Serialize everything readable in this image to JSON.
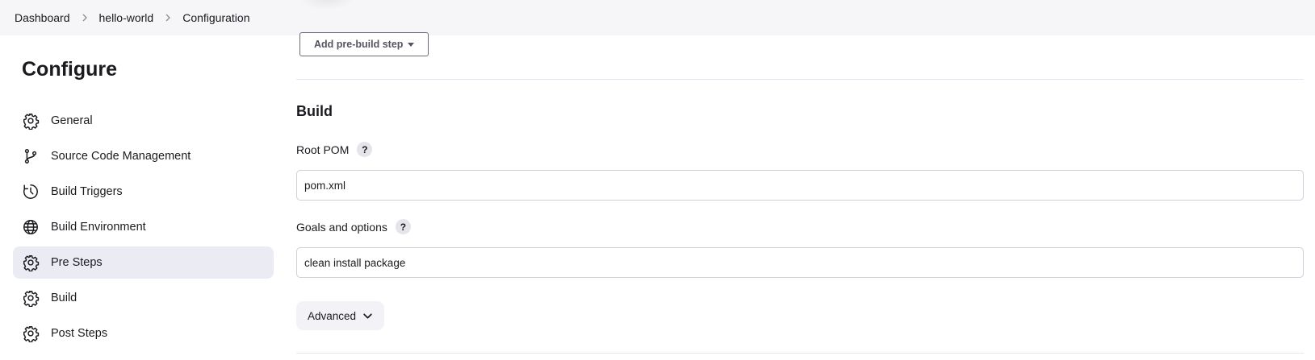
{
  "breadcrumb": {
    "items": [
      "Dashboard",
      "hello-world",
      "Configuration"
    ]
  },
  "sidebar": {
    "heading": "Configure",
    "items": [
      {
        "label": "General",
        "icon": "gear-icon"
      },
      {
        "label": "Source Code Management",
        "icon": "branch-icon"
      },
      {
        "label": "Build Triggers",
        "icon": "clock-icon"
      },
      {
        "label": "Build Environment",
        "icon": "globe-icon"
      },
      {
        "label": "Pre Steps",
        "icon": "gear-icon",
        "active": true
      },
      {
        "label": "Build",
        "icon": "gear-icon"
      },
      {
        "label": "Post Steps",
        "icon": "gear-icon"
      }
    ]
  },
  "main": {
    "prebuild_button": "Add pre-build step",
    "section_title": "Build",
    "root_pom": {
      "label": "Root POM",
      "help": "?",
      "value": "pom.xml"
    },
    "goals": {
      "label": "Goals and options",
      "help": "?",
      "value": "clean install package"
    },
    "advanced_button": "Advanced"
  },
  "colors": {
    "active_nav_bg": "#ebebf3",
    "topbar_bg": "#f6f6f9",
    "text": "#1b1b1f"
  }
}
